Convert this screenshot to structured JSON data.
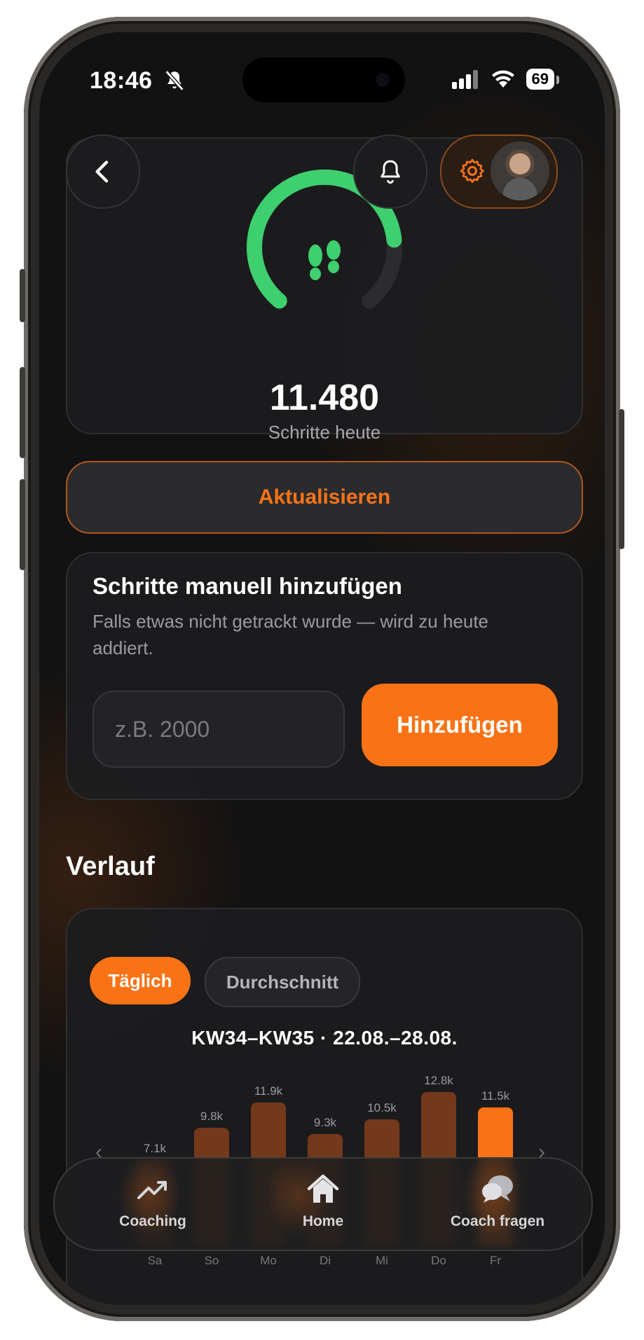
{
  "status_bar": {
    "time": "18:46",
    "battery": "69"
  },
  "header": {
    "back_icon": "chevron-left-icon",
    "bell_icon": "bell-icon",
    "settings_icon": "gear-icon"
  },
  "steps": {
    "value": "11.480",
    "label": "Schritte heute",
    "goal_progress": 0.8,
    "icon": "footprints-icon"
  },
  "update_button": "Aktualisieren",
  "manual": {
    "title": "Schritte manuell hinzufügen",
    "subtitle": "Falls etwas nicht getrackt wurde — wird zu heute addiert.",
    "input_placeholder": "z.B. 2000",
    "add_button": "Hinzufügen"
  },
  "history": {
    "heading": "Verlauf",
    "toggles": [
      "Täglich",
      "Durchschnitt"
    ],
    "active_toggle": "Täglich",
    "range": "KW34–KW35  ·  22.08.–28.08."
  },
  "chart_data": {
    "type": "bar",
    "categories": [
      "Sa",
      "So",
      "Mo",
      "Di",
      "Mi",
      "Do",
      "Fr"
    ],
    "values": [
      7100,
      9800,
      11900,
      9300,
      10500,
      12800,
      11500
    ],
    "value_labels": [
      "7.1k",
      "9.8k",
      "11.9k",
      "9.3k",
      "10.5k",
      "12.8k",
      "11.5k"
    ],
    "highlight_index": 6
  },
  "colors": {
    "accent": "#f97316",
    "bar": "#74391a",
    "ring": "#3ecf6e",
    "background": "#121212"
  },
  "tabbar": {
    "items": [
      {
        "label": "Coaching",
        "icon": "trend-up-icon"
      },
      {
        "label": "Home",
        "icon": "home-icon"
      },
      {
        "label": "Coach fragen",
        "icon": "chat-bubbles-icon"
      }
    ]
  }
}
